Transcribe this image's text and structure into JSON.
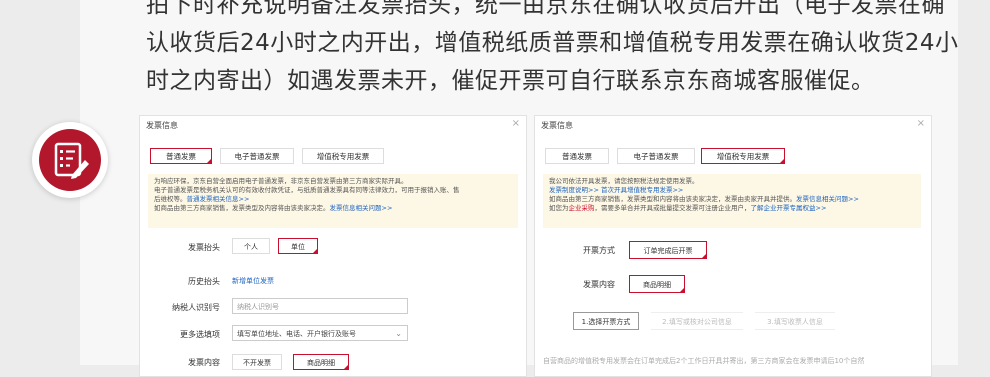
{
  "intro": {
    "line1": "拍下时补充说明备注发票抬头，统一由京东在确认收货后开出（电子发票在确",
    "line2": "认收货后24小时之内开出，增值税纸质普票和增值税专用发票在确认收货24小",
    "line3": "时之内寄出）如遇发票未开，催促开票可自行联系京东商城客服催促。"
  },
  "icon": "invoice-edit-icon",
  "colors": {
    "accent": "#c8102e",
    "badge": "#b3172b",
    "link": "#1d64c2"
  },
  "left_panel": {
    "title": "发票信息",
    "close": "×",
    "tabs": [
      "普通发票",
      "电子普通发票",
      "增值税专用发票"
    ],
    "notice": {
      "l1": "为响应环保，京东自营全面启用电子普通发票，非京东自营发票由第三方商家实际开具。",
      "l2": "电子普通发票是税务机关认可的有效收付款凭证，与纸质普通发票具有同等法律效力，可用于报销入账、售",
      "l3a": "后维权等。",
      "l3b": "普通发票相关信息>>",
      "l4": "如商品由第三方商家销售，发票类型及内容将由该卖家决定。",
      "l4b": "发票信息相关问题>>"
    },
    "header_label": "发票抬头",
    "header_opts": [
      "个人",
      "单位"
    ],
    "history_label": "历史抬头",
    "history_link": "新增单位发票",
    "taxid_label": "纳税人识别号",
    "taxid_placeholder": "纳税人识别号",
    "more_label": "更多选填项",
    "more_value": "填写单位地址、电话、开户银行及账号",
    "content_label": "发票内容",
    "content_opts": [
      "不开发票",
      "商品明细"
    ]
  },
  "right_panel": {
    "title": "发票信息",
    "close": "×",
    "tabs": [
      "普通发票",
      "电子普通发票",
      "增值税专用发票"
    ],
    "notice": {
      "l1": "我公司依法开具发票，请您按照税法规定使用发票。",
      "l2": "发票制度说明>>  首次开具增值税专用发票>>",
      "l3": "如商品由第三方商家销售，发票类型和内容将由该卖家决定，发票由卖家开具并提供。",
      "l3b": "发票信息相关问题>>",
      "l4a": "如您为",
      "l4b": "企业采购",
      "l4c": "，需要多单合并开具或批量提交发票可注册企业用户，",
      "l4d": "了解企业开票专属权益>>"
    },
    "method_label": "开票方式",
    "method_value": "订单完成后开票",
    "content_label": "发票内容",
    "content_value": "商品明细",
    "steps": [
      "1.选择开票方式",
      "2.填写或核对公司信息",
      "3.填写收票人信息"
    ],
    "footer": "自营商品的增值税专用发票会在订单完成后2个工作日开具并寄出，第三方商家会在发票申请后10个自然"
  }
}
